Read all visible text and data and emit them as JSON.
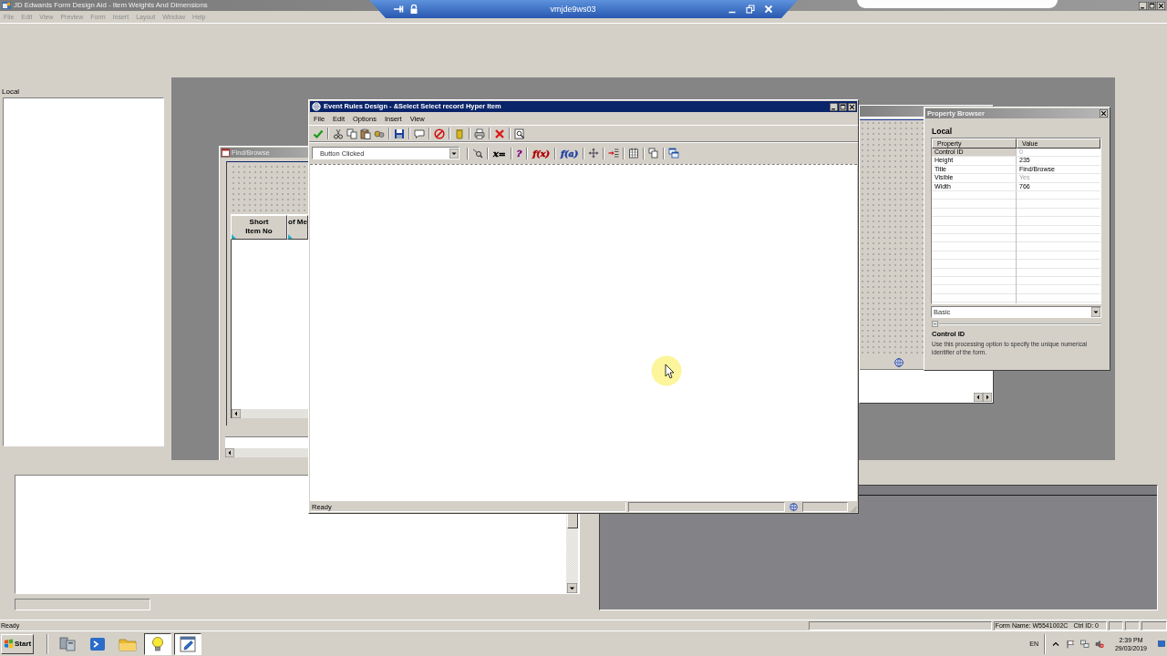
{
  "app": {
    "title": "JD Edwards Form Design Aid - Item Weights And Dimensions",
    "menu": [
      {
        "label": "File",
        "disabled": true
      },
      {
        "label": "Edit",
        "disabled": true
      },
      {
        "label": "View",
        "disabled": true
      },
      {
        "label": "Preview",
        "disabled": true
      },
      {
        "label": "Form",
        "disabled": true
      },
      {
        "label": "Insert",
        "disabled": true
      },
      {
        "label": "Layout",
        "disabled": true
      },
      {
        "label": "Window",
        "disabled": true
      },
      {
        "label": "Help",
        "disabled": true
      }
    ]
  },
  "remote_bar": {
    "host": "vmjde9ws03"
  },
  "left_panel": {
    "title": "Local"
  },
  "find_browse": {
    "title": "Find/Browse",
    "columns": [
      "Short Item No",
      "of Me"
    ]
  },
  "event_rules": {
    "title": "Event Rules Design - &Select Select record Hyper Item",
    "menu": [
      {
        "label": "File",
        "disabled": false
      },
      {
        "label": "Edit",
        "disabled": false
      },
      {
        "label": "Options",
        "disabled": false
      },
      {
        "label": "Insert",
        "disabled": false
      },
      {
        "label": "View",
        "disabled": false
      }
    ],
    "event": "Button Clicked",
    "glyphs": [
      {
        "text": "x=",
        "color": "#000000"
      },
      {
        "text": "?",
        "color": "#800080"
      },
      {
        "text": "f(x)",
        "color": "#b00000"
      },
      {
        "text": "f(a)",
        "color": "#2040a0"
      }
    ],
    "status": "Ready"
  },
  "property_browser": {
    "title": "Property Browser",
    "section": "Local",
    "columns": [
      "Property",
      "Value"
    ],
    "rows": [
      {
        "property": "Control ID",
        "value": "0",
        "selected": true,
        "disabled": true
      },
      {
        "property": "Height",
        "value": "235",
        "selected": false,
        "disabled": false
      },
      {
        "property": "Title",
        "value": "Find/Browse",
        "selected": false,
        "disabled": false
      },
      {
        "property": "Visible",
        "value": "Yes",
        "selected": false,
        "disabled": true
      },
      {
        "property": "Width",
        "value": "766",
        "selected": false,
        "disabled": false
      }
    ],
    "category": "Basic",
    "help_title": "Control ID",
    "help_text": "Use this processing option to specify the unique numerical identifier of the form."
  },
  "status_bar": {
    "text": "Ready",
    "form_name": "Form Name: W5541002C",
    "ctrl_id": "Ctrl ID: 0"
  },
  "taskbar": {
    "start": "Start",
    "buttons": [
      {
        "selected": false
      },
      {
        "selected": false
      },
      {
        "selected": false
      },
      {
        "selected": true
      },
      {
        "selected": true
      }
    ],
    "language": "EN",
    "time": "2:39 PM",
    "date": "29/03/2019"
  }
}
